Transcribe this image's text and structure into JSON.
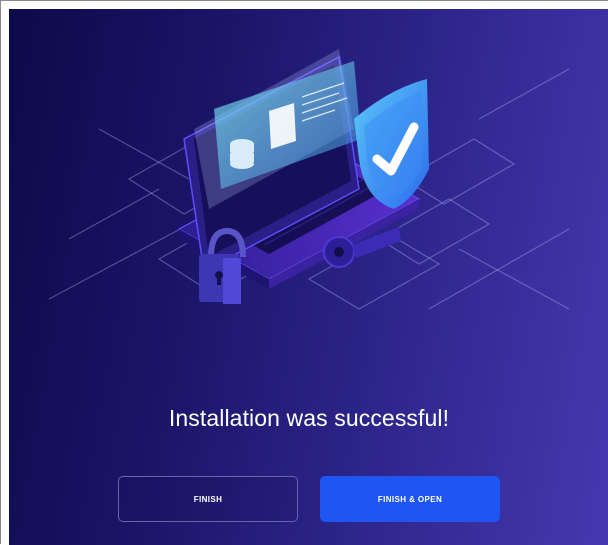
{
  "dialog": {
    "headline": "Installation was successful!",
    "buttons": {
      "finish_label": "FINISH",
      "finish_open_label": "FINISH & OPEN"
    }
  },
  "colors": {
    "background_dark": "#0d0a4a",
    "background_light": "#4638b0",
    "primary_button": "#1f55f2",
    "text": "#ffffff"
  },
  "illustration": {
    "icons": [
      "laptop-icon",
      "shield-checkmark-icon",
      "padlock-icon",
      "key-icon",
      "database-icon",
      "document-icon"
    ]
  }
}
